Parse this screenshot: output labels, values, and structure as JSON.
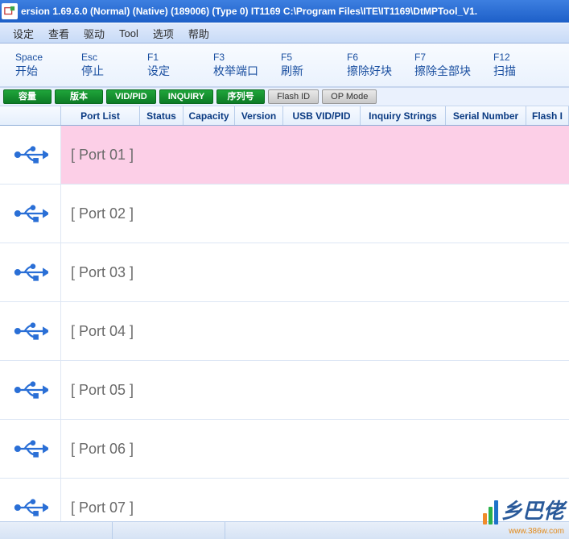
{
  "title": "ersion 1.69.6.0 (Normal) (Native) (189006) (Type 0) IT1169 C:\\Program Files\\ITE\\IT1169\\DtMPTool_V1.",
  "menubar": [
    "设定",
    "查看",
    "驱动",
    "Tool",
    "选项",
    "帮助"
  ],
  "toolbar": [
    {
      "key": "Space",
      "label": "开始"
    },
    {
      "key": "Esc",
      "label": "停止"
    },
    {
      "key": "F1",
      "label": "设定"
    },
    {
      "key": "F3",
      "label": "枚举端口"
    },
    {
      "key": "F5",
      "label": "刷新"
    },
    {
      "key": "F6",
      "label": "擦除好块"
    },
    {
      "key": "F7",
      "label": "擦除全部块"
    },
    {
      "key": "F12",
      "label": "扫描"
    }
  ],
  "tabs": [
    {
      "label": "容量",
      "alt": false
    },
    {
      "label": "版本",
      "alt": false
    },
    {
      "label": "VID/PID",
      "alt": false
    },
    {
      "label": "INQUIRY",
      "alt": false
    },
    {
      "label": "序列号",
      "alt": false
    },
    {
      "label": "Flash ID",
      "alt": true
    },
    {
      "label": "OP Mode",
      "alt": true
    }
  ],
  "columns": {
    "icon": "",
    "port": "Port List",
    "status": "Status",
    "capacity": "Capacity",
    "version": "Version",
    "vidpid": "USB VID/PID",
    "inquiry": "Inquiry Strings",
    "serial": "Serial Number",
    "flash": "Flash I"
  },
  "ports": [
    {
      "label": "[ Port 01 ]",
      "selected": true
    },
    {
      "label": "[ Port 02 ]",
      "selected": false
    },
    {
      "label": "[ Port 03 ]",
      "selected": false
    },
    {
      "label": "[ Port 04 ]",
      "selected": false
    },
    {
      "label": "[ Port 05 ]",
      "selected": false
    },
    {
      "label": "[ Port 06 ]",
      "selected": false
    },
    {
      "label": "[ Port 07 ]",
      "selected": false
    }
  ],
  "watermark": {
    "text": "乡巴佬",
    "url": "www.386w.com"
  }
}
